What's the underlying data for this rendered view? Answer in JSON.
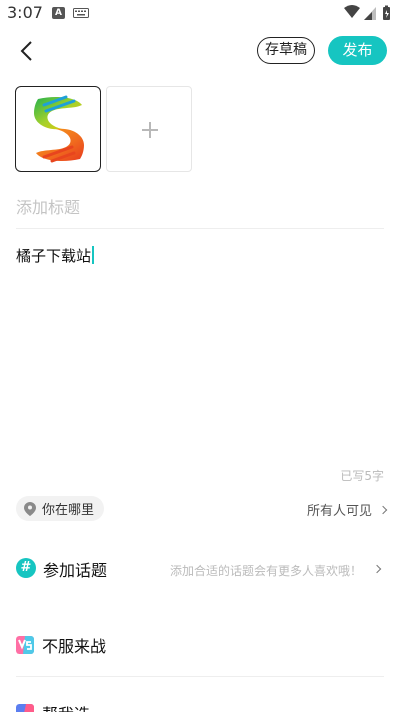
{
  "status_bar": {
    "time": "3:07",
    "a_badge": "A"
  },
  "toolbar": {
    "draft_label": "存草稿",
    "publish_label": "发布"
  },
  "editor": {
    "title_placeholder": "添加标题",
    "body_text": "橘子下载站",
    "char_count": "已写5字"
  },
  "location": {
    "label": "你在哪里",
    "visibility": "所有人可见"
  },
  "topic": {
    "icon_glyph": "#",
    "label": "参加话题",
    "hint": "添加合适的话题会有更多人喜欢哦！"
  },
  "sections": [
    {
      "label": "不服来战",
      "icon": "versus-icon"
    },
    {
      "label": "帮我选",
      "icon": "pk-icon"
    }
  ],
  "colors": {
    "accent": "#16c5c1"
  }
}
